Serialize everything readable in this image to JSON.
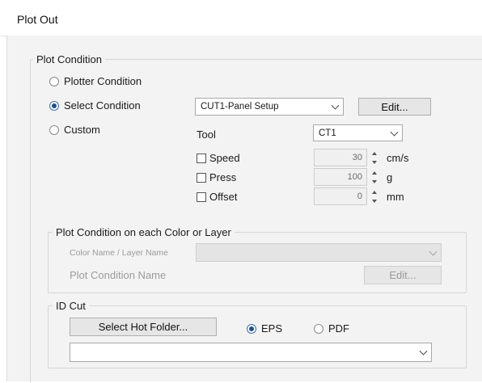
{
  "window": {
    "title": "Plot Out"
  },
  "plot_condition": {
    "group_label": "Plot Condition",
    "radios": {
      "plotter": {
        "label": "Plotter Condition",
        "checked": false
      },
      "select": {
        "label": "Select Condition",
        "checked": true
      },
      "custom": {
        "label": "Custom",
        "checked": false
      }
    },
    "condition_select_value": "CUT1-Panel Setup",
    "edit_button": "Edit...",
    "tool_label": "Tool",
    "tool_value": "CT1",
    "settings": {
      "speed": {
        "label": "Speed",
        "value": "30",
        "unit": "cm/s",
        "checked": false
      },
      "press": {
        "label": "Press",
        "value": "100",
        "unit": "g",
        "checked": false
      },
      "offset": {
        "label": "Offset",
        "value": "0",
        "unit": "mm",
        "checked": false
      }
    }
  },
  "color_layer": {
    "group_label": "Plot Condition on each Color or Layer",
    "color_name_label": "Color Name / Layer Name",
    "color_name_value": "",
    "plot_condition_name_label": "Plot Condition Name",
    "edit_button": "Edit..."
  },
  "id_cut": {
    "group_label": "ID Cut",
    "hot_folder_button": "Select Hot Folder...",
    "format_radios": {
      "eps": {
        "label": "EPS",
        "checked": true
      },
      "pdf": {
        "label": "PDF",
        "checked": false
      }
    },
    "folder_value": ""
  },
  "colors": {
    "accent": "#1c4f8c",
    "panel_bg": "#f3f3f3",
    "disabled_text": "#9b9b9b"
  }
}
